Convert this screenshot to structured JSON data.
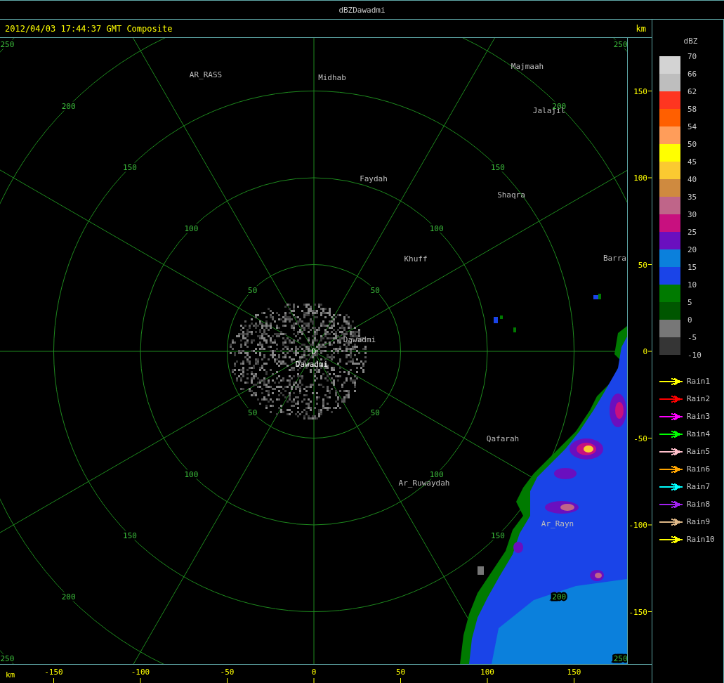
{
  "window": {
    "title": "dBZDawadmi"
  },
  "header": {
    "timestamp": "2012/04/03 17:44:37 GMT Composite",
    "unit": "km"
  },
  "map": {
    "rings": [
      {
        "labels": [
          "50",
          "50",
          "50",
          "50"
        ]
      },
      {
        "labels": [
          "100",
          "100",
          "100",
          "100"
        ]
      },
      {
        "labels": [
          "150",
          "150",
          "150",
          "150"
        ]
      },
      {
        "labels": [
          "200",
          "200",
          "200",
          "200"
        ]
      },
      {
        "labels": [
          "250",
          "250",
          "250",
          "250"
        ]
      }
    ],
    "places": [
      {
        "name": "AR_RASS",
        "kind": "place"
      },
      {
        "name": "Midhab",
        "kind": "place"
      },
      {
        "name": "Majmaah",
        "kind": "place"
      },
      {
        "name": "Jalajil",
        "kind": "place"
      },
      {
        "name": "Faydah",
        "kind": "place"
      },
      {
        "name": "Shaqra",
        "kind": "place"
      },
      {
        "name": "Khuff",
        "kind": "place"
      },
      {
        "name": "Barra",
        "kind": "place"
      },
      {
        "name": "Dawadmi",
        "kind": "place"
      },
      {
        "name": "Dawadmi",
        "kind": "site"
      },
      {
        "name": "Qafarah",
        "kind": "place"
      },
      {
        "name": "Ar_Ruwaydah",
        "kind": "place"
      },
      {
        "name": "Ar_Rayn",
        "kind": "place"
      }
    ],
    "radar_marker": "D"
  },
  "y_axis": {
    "ticks": [
      "150",
      "100",
      "50",
      "0",
      "-50",
      "-100",
      "-150"
    ]
  },
  "x_axis": {
    "unit": "km",
    "ticks": [
      "-150",
      "-100",
      "-50",
      "0",
      "50",
      "100",
      "150"
    ]
  },
  "legend": {
    "title": "dBZ",
    "scale_labels": [
      "70",
      "66",
      "62",
      "58",
      "54",
      "50",
      "45",
      "40",
      "35",
      "30",
      "25",
      "20",
      "15",
      "10",
      "5",
      "0",
      "-5",
      "-10"
    ],
    "bins": [
      {
        "color": "#d3d3d3"
      },
      {
        "color": "#bebebe"
      },
      {
        "color": "#fe3520"
      },
      {
        "color": "#ff5f00"
      },
      {
        "color": "#ff9d5a"
      },
      {
        "color": "#ffff00"
      },
      {
        "color": "#fbca31"
      },
      {
        "color": "#cf8a3f"
      },
      {
        "color": "#bf6589"
      },
      {
        "color": "#c8107f"
      },
      {
        "color": "#6a0fbf"
      },
      {
        "color": "#0b80dc"
      },
      {
        "color": "#1a44e8"
      },
      {
        "color": "#007a00"
      },
      {
        "color": "#005600"
      },
      {
        "color": "#777777"
      },
      {
        "color": "#353535"
      }
    ],
    "tracks": [
      {
        "label": "Rain1",
        "color": "#ffff00"
      },
      {
        "label": "Rain2",
        "color": "#ff0000"
      },
      {
        "label": "Rain3",
        "color": "#ff00ff"
      },
      {
        "label": "Rain4",
        "color": "#00ff00"
      },
      {
        "label": "Rain5",
        "color": "#ffc0cb"
      },
      {
        "label": "Rain6",
        "color": "#ffa500"
      },
      {
        "label": "Rain7",
        "color": "#00ffff"
      },
      {
        "label": "Rain8",
        "color": "#a020f0"
      },
      {
        "label": "Rain9",
        "color": "#deb887"
      },
      {
        "label": "Rain10",
        "color": "#ffff00"
      }
    ]
  }
}
